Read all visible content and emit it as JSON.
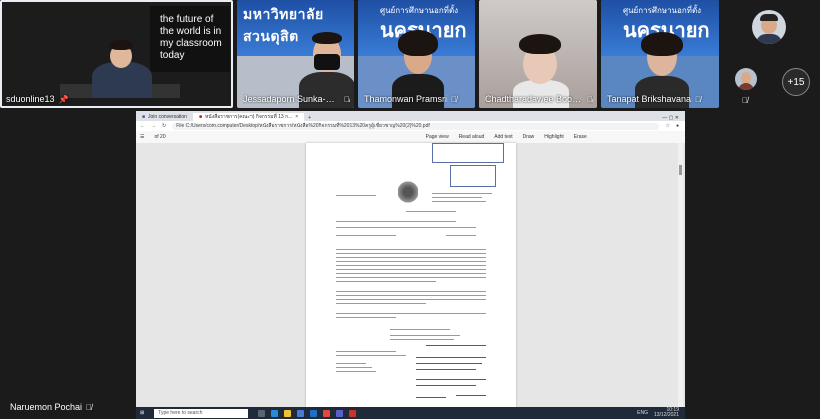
{
  "participants": [
    {
      "name": "sduonline13",
      "pinned": true,
      "board_text": "the future of the world is in my classroom today"
    },
    {
      "name": "Jessadaporn Sunka-Anu...",
      "muted": true,
      "banner": "มหาวิทยาลัยสวนดุสิต"
    },
    {
      "name": "Thamonwan Pramsri",
      "muted": true,
      "banner_small": "ศูนย์การศึกษานอกที่ตั้ง",
      "banner_large": "นครนายก"
    },
    {
      "name": "Chadtharadawee Boont...",
      "muted": true
    },
    {
      "name": "Tanapat Brikshavana",
      "muted": true,
      "banner_small": "ศูนย์การศึกษานอกที่ตั้ง",
      "banner_large": "นครนายก"
    }
  ],
  "more_count": "+15",
  "self_name": "Naruemon Pochai",
  "share": {
    "tabs": [
      "Join conversation",
      "หนังสือราชการ(คณะฯ) กิจกรรมที่ 13 ก..."
    ],
    "address": "File   C:/Users/com.computer/Desktop/หนังสือราชการ/หนังสือ%20กิจกรรมที่%2013%20ครูผู้เชี่ยวชาญ%20(2)%20.pdf",
    "page_indicator": "of 20",
    "pdf_tools": [
      "Page view",
      "Read aloud",
      "Add text",
      "Draw",
      "Highlight",
      "Erase"
    ],
    "taskbar_search": "Type here to search",
    "clock_time": "10:19",
    "clock_date": "13/12/2021",
    "lang": "ENG"
  }
}
